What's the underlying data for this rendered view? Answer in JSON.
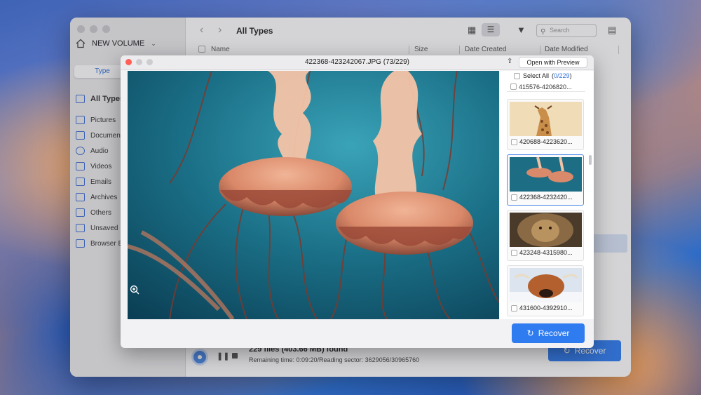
{
  "app": {
    "volume_name": "NEW VOLUME",
    "type_tab": "Type",
    "sidebar": [
      {
        "label": "All Types",
        "icon": "all-types-icon",
        "active": true
      },
      {
        "label": "Pictures",
        "icon": "pictures-icon"
      },
      {
        "label": "Documents",
        "icon": "documents-icon"
      },
      {
        "label": "Audio",
        "icon": "audio-icon"
      },
      {
        "label": "Videos",
        "icon": "videos-icon"
      },
      {
        "label": "Emails",
        "icon": "emails-icon"
      },
      {
        "label": "Archives",
        "icon": "archives-icon"
      },
      {
        "label": "Others",
        "icon": "others-icon"
      },
      {
        "label": "Unsaved Files",
        "icon": "unsaved-icon"
      },
      {
        "label": "Browser Bookmarks",
        "icon": "browser-icon"
      }
    ],
    "page_title": "All Types",
    "search_placeholder": "Search",
    "columns": {
      "name": "Name",
      "size": "Size",
      "created": "Date Created",
      "modified": "Date Modified"
    },
    "status_main": "229 files (403.66 MB) found",
    "status_sub": "Remaining time: 0:09:20/Reading sector: 3629056/30965760",
    "recover_label": "Recover",
    "accent_color": "#2f7cf0"
  },
  "preview": {
    "filename": "422368-423242067.JPG (73/229)",
    "open_with": "Open with Preview",
    "select_all_label": "Select All",
    "select_all_open": "(",
    "select_all_count": "0/229",
    "select_all_close": ")",
    "thumbnails": [
      {
        "label": "415576-4206820...",
        "partial": true
      },
      {
        "label": "420688-4223620...",
        "image": "giraffe"
      },
      {
        "label": "422368-4232420...",
        "image": "jellyfish",
        "selected": true
      },
      {
        "label": "423248-4315980...",
        "image": "lion"
      },
      {
        "label": "431600-4392910...",
        "image": "highland-cow"
      }
    ],
    "recover_label": "Recover"
  }
}
